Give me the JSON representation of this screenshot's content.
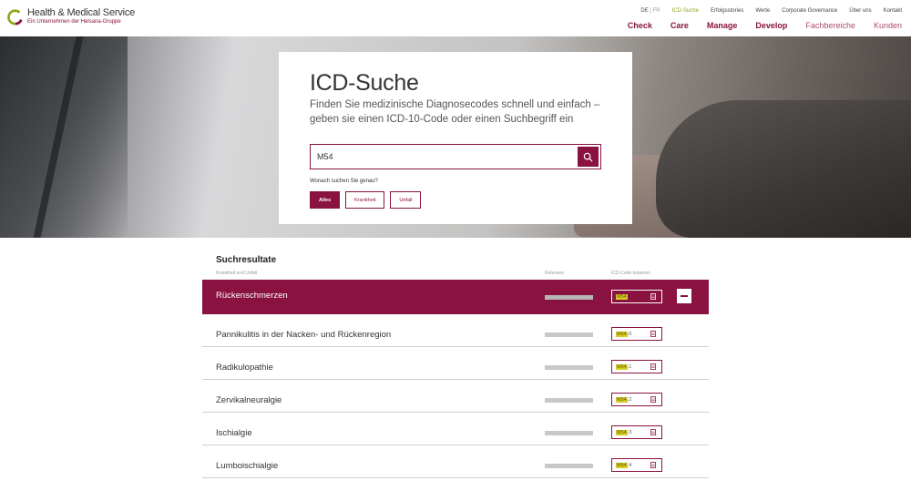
{
  "logo": {
    "brand": "Health & Medical Service",
    "sub": "Ein Unternehmen der Helsana-Gruppe"
  },
  "topnav": {
    "lang_active": "DE",
    "lang_sep": " | ",
    "lang_other": "FR",
    "items": [
      "ICD-Suche",
      "Erfolgsstories",
      "Werte",
      "Corporate Governance",
      "Über uns",
      "Kontakt"
    ]
  },
  "mainnav": [
    "Check",
    "Care",
    "Manage",
    "Develop",
    "Fachbereiche",
    "Kunden"
  ],
  "search_card": {
    "title": "ICD-Suche",
    "intro": "Finden Sie medizinische Diagnosecodes schnell und einfach – geben sie einen ICD-10-Code oder einen Suchbegriff ein",
    "query": "M54",
    "filter_question": "Wonach suchen Sie genau?",
    "filters": [
      "Alles",
      "Krankheit",
      "Unfall"
    ],
    "active_filter": "Alles"
  },
  "results": {
    "title": "Suchresultate",
    "col_name": "Krankheit und Unfall",
    "col_relevance": "Relevanz",
    "col_code": "ICD-Code kopieren",
    "rows": [
      {
        "name": "Rückenschmerzen",
        "code_hl": "M54",
        "code_rest": "",
        "expanded": true
      },
      {
        "name": "Pannikulitis in der Nacken- und Rückenregion",
        "code_hl": "M54",
        "code_rest": ".0",
        "expanded": false
      },
      {
        "name": "Radikulopathie",
        "code_hl": "M54",
        "code_rest": ".1",
        "expanded": false
      },
      {
        "name": "Zervikalneuralgie",
        "code_hl": "M54",
        "code_rest": ".2",
        "expanded": false
      },
      {
        "name": "Ischialgie",
        "code_hl": "M54",
        "code_rest": ".3",
        "expanded": false
      },
      {
        "name": "Lumboischialgie",
        "code_hl": "M54",
        "code_rest": ".4",
        "expanded": false
      }
    ]
  },
  "colors": {
    "brand": "#8a1240",
    "accent_green": "#8ea81e",
    "highlight": "#d5cd2b"
  }
}
